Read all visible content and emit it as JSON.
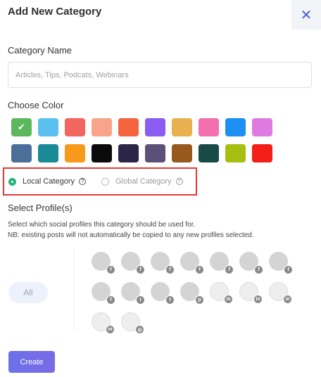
{
  "modal": {
    "title": "Add New Category",
    "close_icon": "close-icon"
  },
  "category_name": {
    "label": "Category Name",
    "placeholder": "Articles, Tips, Podcats, Webinars"
  },
  "color": {
    "label": "Choose Color",
    "swatches": [
      "#5cb85c",
      "#5bc0f0",
      "#f2665f",
      "#f9a38a",
      "#f4643c",
      "#8a5cf0",
      "#e9b04f",
      "#f36fae",
      "#1e8ff2",
      "#de7ae0",
      "#4c6f9a",
      "#1a8a96",
      "#f79a1c",
      "#0b0b0b",
      "#2b2547",
      "#5a5078",
      "#975a1e",
      "#1a4a48",
      "#a6bf10",
      "#f31e15"
    ],
    "selected_index": 0
  },
  "category_type": {
    "local_label": "Local Category",
    "global_label": "Global Category",
    "selected": "local"
  },
  "profiles": {
    "label": "Select Profile(s)",
    "desc_line1": "Select which social profiles this category should be used for.",
    "desc_line2": "NB: existing posts will not automatically be copied to any new profiles selected.",
    "all_label": "All",
    "items": [
      {
        "network": "facebook",
        "badge": "f"
      },
      {
        "network": "facebook",
        "badge": "f"
      },
      {
        "network": "facebook",
        "badge": "f"
      },
      {
        "network": "facebook",
        "badge": "f"
      },
      {
        "network": "facebook",
        "badge": "f"
      },
      {
        "network": "facebook",
        "badge": "f"
      },
      {
        "network": "facebook",
        "badge": "f"
      },
      {
        "network": "facebook",
        "badge": "f"
      },
      {
        "network": "twitter",
        "badge": "t"
      },
      {
        "network": "twitter",
        "badge": "t"
      },
      {
        "network": "pinterest",
        "badge": "p"
      },
      {
        "network": "linkedin",
        "badge": "in"
      },
      {
        "network": "linkedin",
        "badge": "in"
      },
      {
        "network": "linkedin",
        "badge": "in"
      },
      {
        "network": "linkedin",
        "badge": "in"
      },
      {
        "network": "instagram",
        "badge": "◎"
      }
    ]
  },
  "actions": {
    "create_label": "Create"
  }
}
